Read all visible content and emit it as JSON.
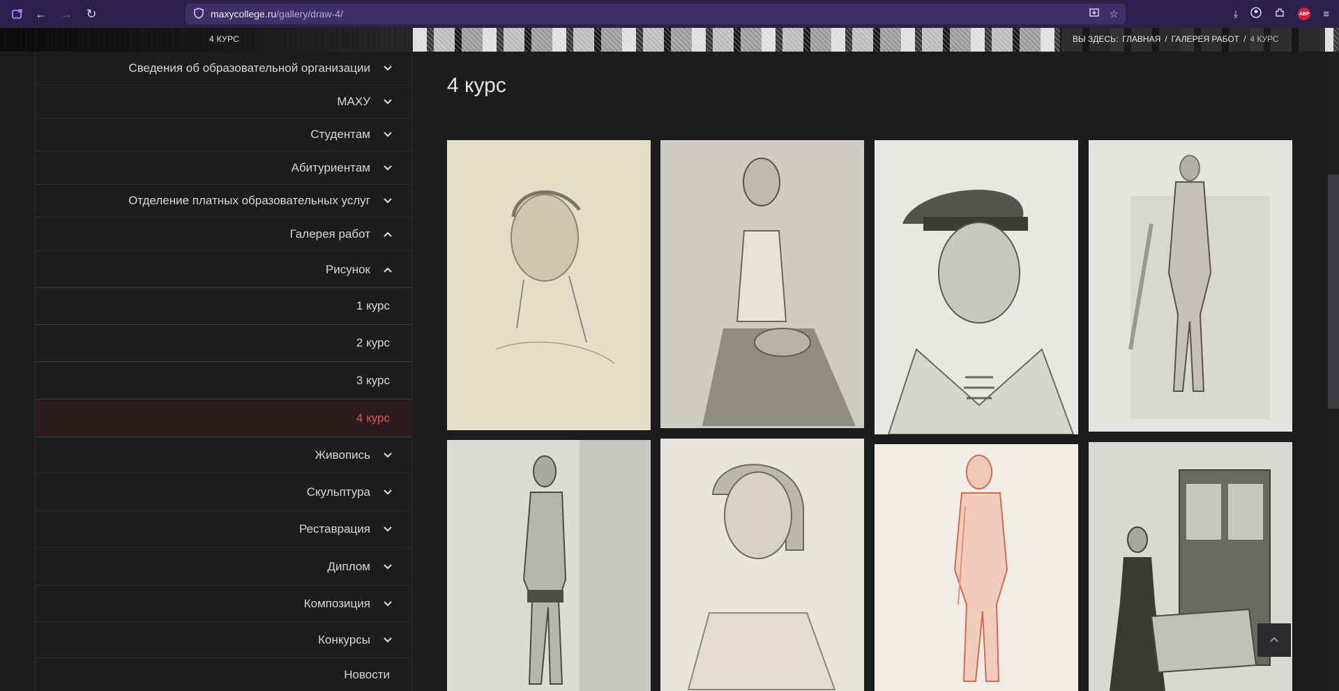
{
  "browser": {
    "url_host": "maxycollege.ru",
    "url_path": "/gallery/draw-4/"
  },
  "banner": {
    "section_title": "4 КУРС",
    "breadcrumb": {
      "prefix": "ВЫ ЗДЕСЬ:",
      "home": "ГЛАВНАЯ",
      "sep1": "/",
      "gallery": "ГАЛЕРЕЯ РАБОТ",
      "sep2": "/",
      "current": "4 КУРС"
    }
  },
  "sidebar": {
    "items": [
      {
        "label": "Сведения об образовательной организации"
      },
      {
        "label": "МАХУ"
      },
      {
        "label": "Студентам"
      },
      {
        "label": "Абитуриентам"
      },
      {
        "label": "Отделение платных образовательных услуг"
      },
      {
        "label": "Галерея работ"
      },
      {
        "label": "Рисунок"
      }
    ],
    "sub_items": [
      {
        "label": "1 курс"
      },
      {
        "label": "2 курс"
      },
      {
        "label": "3 курс"
      },
      {
        "label": "4 курс"
      }
    ],
    "items_after": [
      {
        "label": "Живопись"
      },
      {
        "label": "Скульптура"
      },
      {
        "label": "Реставрация"
      },
      {
        "label": "Диплом"
      },
      {
        "label": "Композиция"
      },
      {
        "label": "Конкурсы"
      },
      {
        "label": "Новости"
      }
    ]
  },
  "main": {
    "title": "4 курс"
  },
  "colors": {
    "background": "#1b1c1e",
    "active_item_text": "#e0505c",
    "active_item_bg": "#2c1b1d",
    "browser_chrome": "#2b1f4b"
  }
}
